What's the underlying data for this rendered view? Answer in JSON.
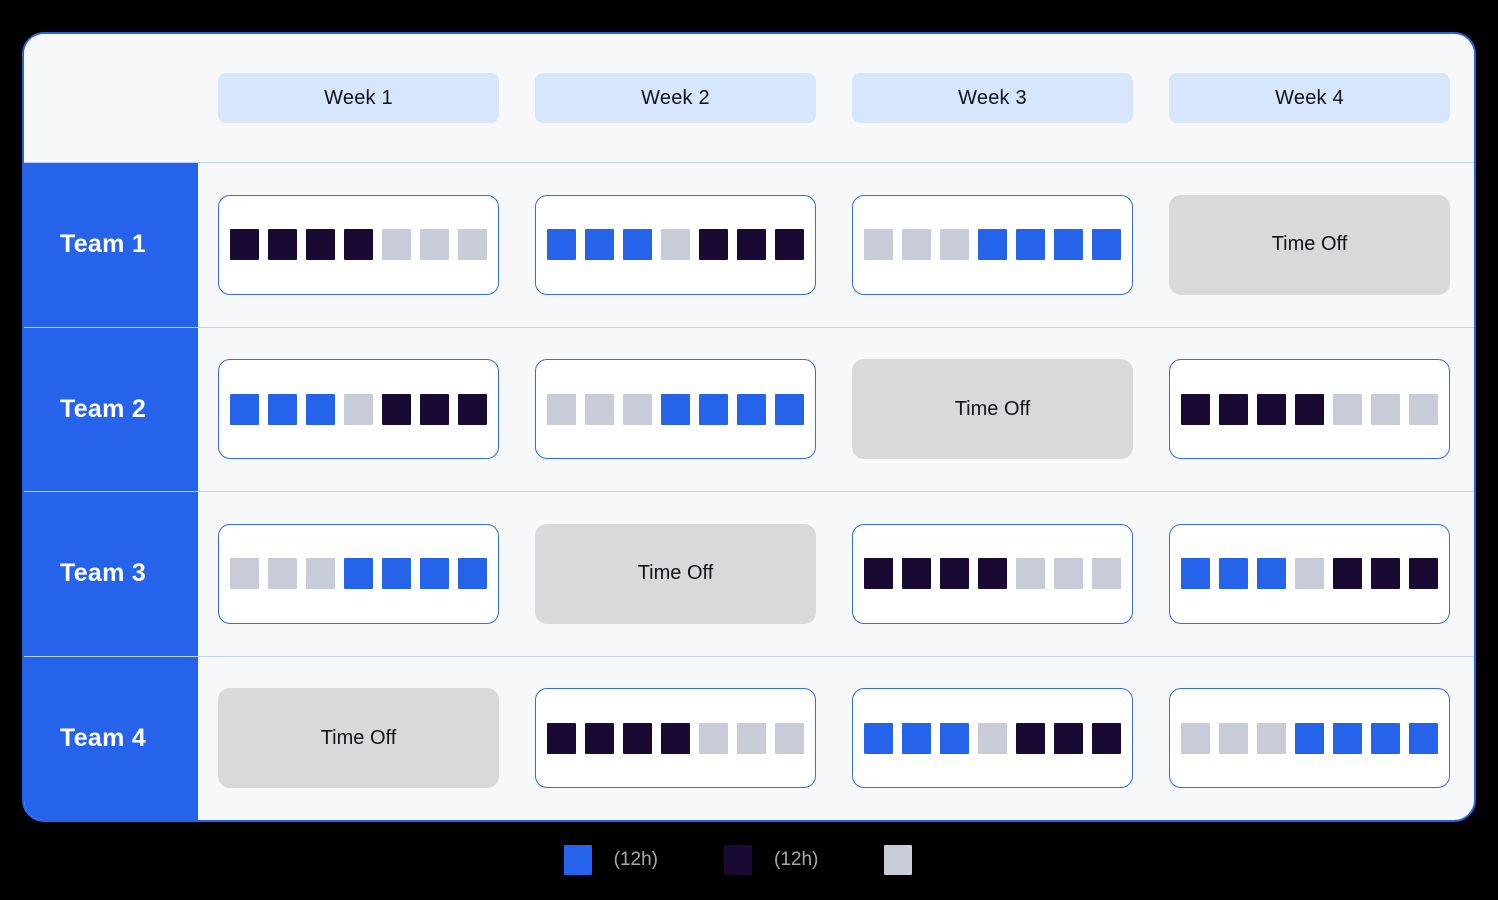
{
  "header": {
    "weeks": [
      {
        "label": "Week 1"
      },
      {
        "label": "Week 2"
      },
      {
        "label": "Week 3"
      },
      {
        "label": "Week 4"
      }
    ]
  },
  "legend": {
    "items": [
      {
        "swatch": "day",
        "swatch_color": "#2563eb",
        "label": "",
        "hours": "(12h)"
      },
      {
        "swatch": "night",
        "swatch_color": "#190a33",
        "label": "",
        "hours": "(12h)"
      },
      {
        "swatch": "off",
        "swatch_color": "#c7ccd8",
        "label": "",
        "hours": ""
      }
    ]
  },
  "colors": {
    "accent": "#2563eb",
    "day_shift": "#2563eb",
    "night_shift": "#190a33",
    "off_day": "#c7ccd8",
    "time_off_block": "#d7d9dd",
    "week_tab": "#d6e6fd",
    "surface": "#f7f8fa",
    "row_divider": "#bed2f7"
  },
  "time_off_label": "Time Off",
  "rows": [
    {
      "team": "Team 1",
      "weeks": [
        {
          "type": "shifts",
          "days": [
            "night",
            "night",
            "night",
            "night",
            "off",
            "off",
            "off"
          ]
        },
        {
          "type": "shifts",
          "days": [
            "day",
            "day",
            "day",
            "off",
            "night",
            "night",
            "night"
          ]
        },
        {
          "type": "shifts",
          "days": [
            "off",
            "off",
            "off",
            "day",
            "day",
            "day",
            "day"
          ]
        },
        {
          "type": "timeoff",
          "label": "Time Off"
        }
      ]
    },
    {
      "team": "Team 2",
      "weeks": [
        {
          "type": "shifts",
          "days": [
            "day",
            "day",
            "day",
            "off",
            "night",
            "night",
            "night"
          ]
        },
        {
          "type": "shifts",
          "days": [
            "off",
            "off",
            "off",
            "day",
            "day",
            "day",
            "day"
          ]
        },
        {
          "type": "timeoff",
          "label": "Time Off"
        },
        {
          "type": "shifts",
          "days": [
            "night",
            "night",
            "night",
            "night",
            "off",
            "off",
            "off"
          ]
        }
      ]
    },
    {
      "team": "Team 3",
      "weeks": [
        {
          "type": "shifts",
          "days": [
            "off",
            "off",
            "off",
            "day",
            "day",
            "day",
            "day"
          ]
        },
        {
          "type": "timeoff",
          "label": "Time Off"
        },
        {
          "type": "shifts",
          "days": [
            "night",
            "night",
            "night",
            "night",
            "off",
            "off",
            "off"
          ]
        },
        {
          "type": "shifts",
          "days": [
            "day",
            "day",
            "day",
            "off",
            "night",
            "night",
            "night"
          ]
        }
      ]
    },
    {
      "team": "Team 4",
      "weeks": [
        {
          "type": "timeoff",
          "label": "Time Off"
        },
        {
          "type": "shifts",
          "days": [
            "night",
            "night",
            "night",
            "night",
            "off",
            "off",
            "off"
          ]
        },
        {
          "type": "shifts",
          "days": [
            "day",
            "day",
            "day",
            "off",
            "night",
            "night",
            "night"
          ]
        },
        {
          "type": "shifts",
          "days": [
            "off",
            "off",
            "off",
            "day",
            "day",
            "day",
            "day"
          ]
        }
      ]
    }
  ]
}
